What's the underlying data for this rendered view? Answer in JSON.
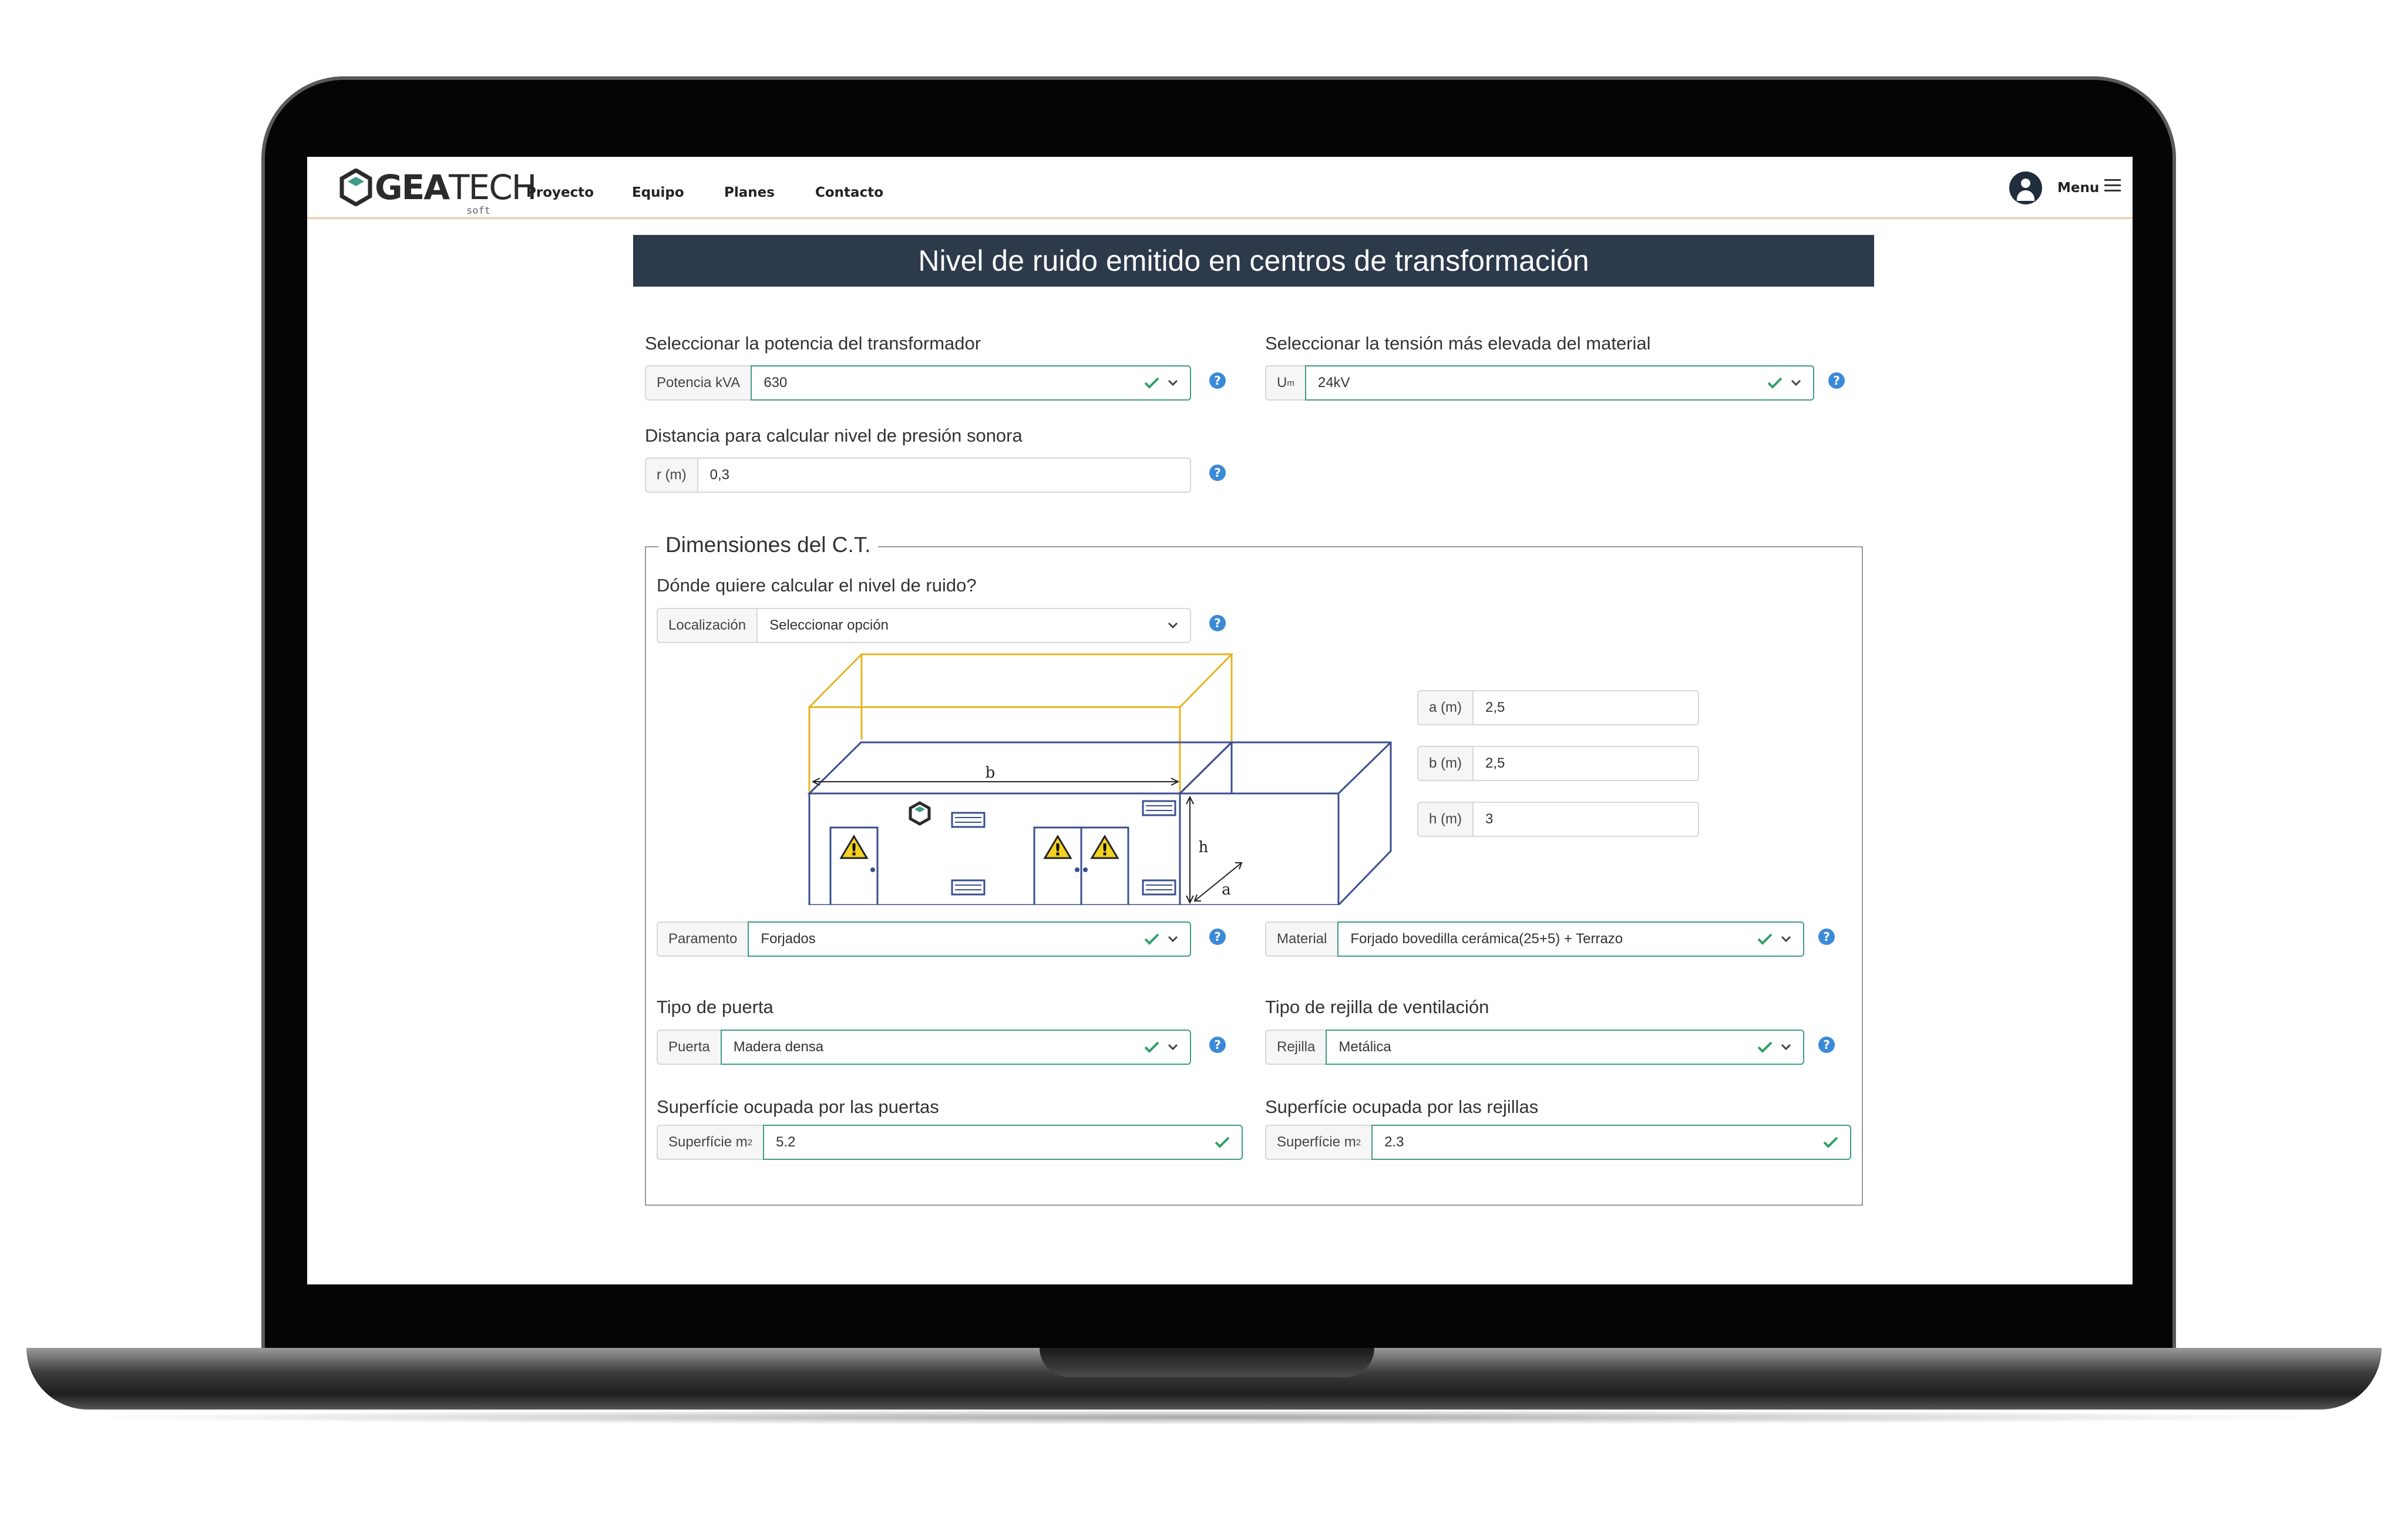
{
  "nav": {
    "logo_main": "GEA",
    "logo_thin": "TECH",
    "logo_sub": "soft",
    "items": [
      "Proyecto",
      "Equipo",
      "Planes",
      "Contacto"
    ],
    "menu_label": "Menu"
  },
  "page": {
    "title": "Nivel de ruido emitido en centros de transformación"
  },
  "transformer": {
    "label": "Seleccionar la potencia del transformador",
    "prefix": "Potencia kVA",
    "value": "630"
  },
  "voltage": {
    "label": "Seleccionar la tensión más elevada del material",
    "prefix": "U",
    "prefix_sub": "m",
    "value": "24kV"
  },
  "distance": {
    "label": "Distancia para calcular nivel de presión sonora",
    "prefix": "r (m)",
    "value": "0,3"
  },
  "dimensions": {
    "legend": "Dimensiones del C.T.",
    "location_label": "Dónde quiere calcular el nivel de ruido?",
    "location_prefix": "Localización",
    "location_value": "Seleccionar opción",
    "a": {
      "prefix": "a (m)",
      "value": "2,5"
    },
    "b": {
      "prefix": "b (m)",
      "value": "2,5"
    },
    "h": {
      "prefix": "h (m)",
      "value": "3"
    },
    "diagram_labels": {
      "b": "b",
      "h": "h",
      "a": "a"
    },
    "paramento": {
      "prefix": "Paramento",
      "value": "Forjados"
    },
    "material": {
      "prefix": "Material",
      "value": "Forjado bovedilla cerámica(25+5) + Terrazo"
    },
    "door": {
      "label": "Tipo de puerta",
      "prefix": "Puerta",
      "value": "Madera densa"
    },
    "grille": {
      "label": "Tipo de rejilla de ventilación",
      "prefix": "Rejilla",
      "value": "Metálica"
    },
    "door_surface": {
      "label": "Superfície ocupada por las puertas",
      "prefix": "Superfície m",
      "prefix_sup": "2",
      "value": "5.2"
    },
    "grille_surface": {
      "label": "Superfície ocupada por las rejillas",
      "prefix": "Superfície m",
      "prefix_sup": "2",
      "value": "2.3"
    }
  },
  "help_glyph": "?",
  "icons": {
    "help": "help-icon",
    "check": "check-icon",
    "dropdown": "chevron-down-icon",
    "avatar": "user-avatar-icon",
    "menu": "hamburger-menu-icon"
  },
  "colors": {
    "title_bar": "#2d3a4b",
    "valid_border": "#3f9b86",
    "help": "#3b8ad8",
    "nav_border": "#f3c9a8",
    "diagram_outline": "#3a4f8f",
    "diagram_yellow": "#e6b422"
  }
}
